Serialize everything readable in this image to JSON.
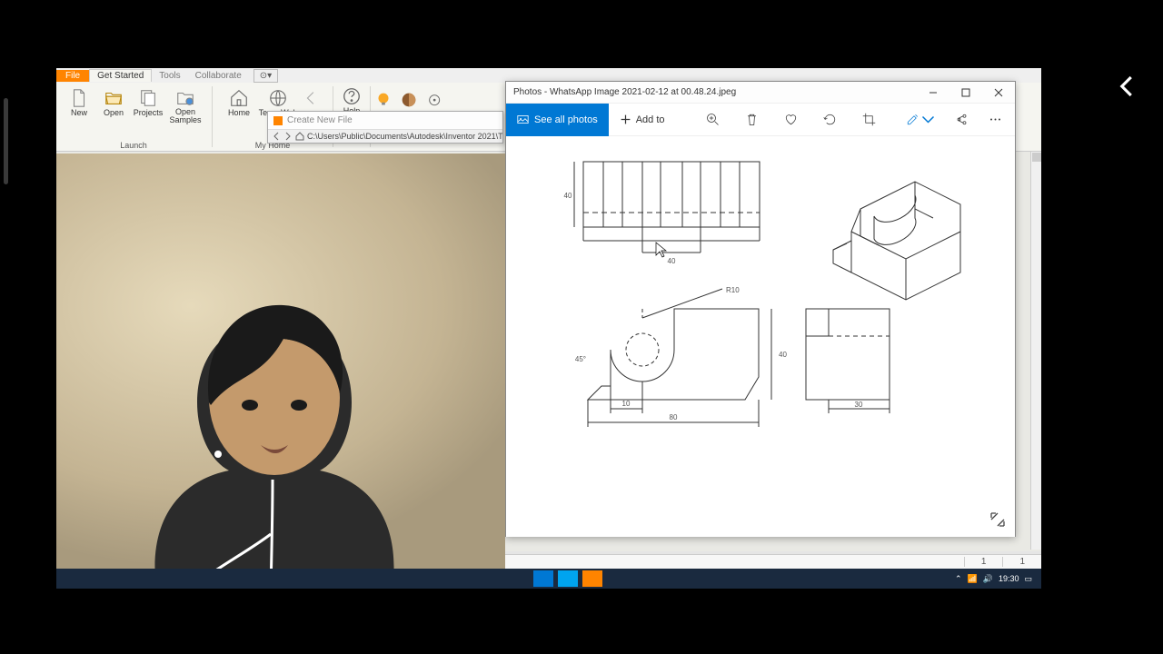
{
  "inventor": {
    "tabs": {
      "file": "File",
      "get_started": "Get Started",
      "tools": "Tools",
      "collab": "Collaborate"
    },
    "ribbon": {
      "new": "New",
      "open": "Open",
      "projects": "Projects",
      "open_samples": "Open\nSamples",
      "home": "Home",
      "team_web": "Team Web",
      "help": "Help",
      "grp_launch": "Launch",
      "grp_myhome": "My Home"
    },
    "popup": {
      "title": "Create New File",
      "path": "C:\\Users\\Public\\Documents\\Autodesk\\Inventor 2021\\T"
    },
    "status": {
      "a": "1",
      "b": "1"
    }
  },
  "photos": {
    "title": "Photos - WhatsApp Image 2021-02-12 at 00.48.24.jpeg",
    "see_all": "See all photos",
    "add_to": "Add to",
    "dims": {
      "d40a": "40",
      "d40b": "40",
      "d40c": "40",
      "r10": "R10",
      "ang45": "45°",
      "d10": "10",
      "d80": "80",
      "d30": "30"
    }
  },
  "taskbar": {
    "time": "19:30"
  }
}
